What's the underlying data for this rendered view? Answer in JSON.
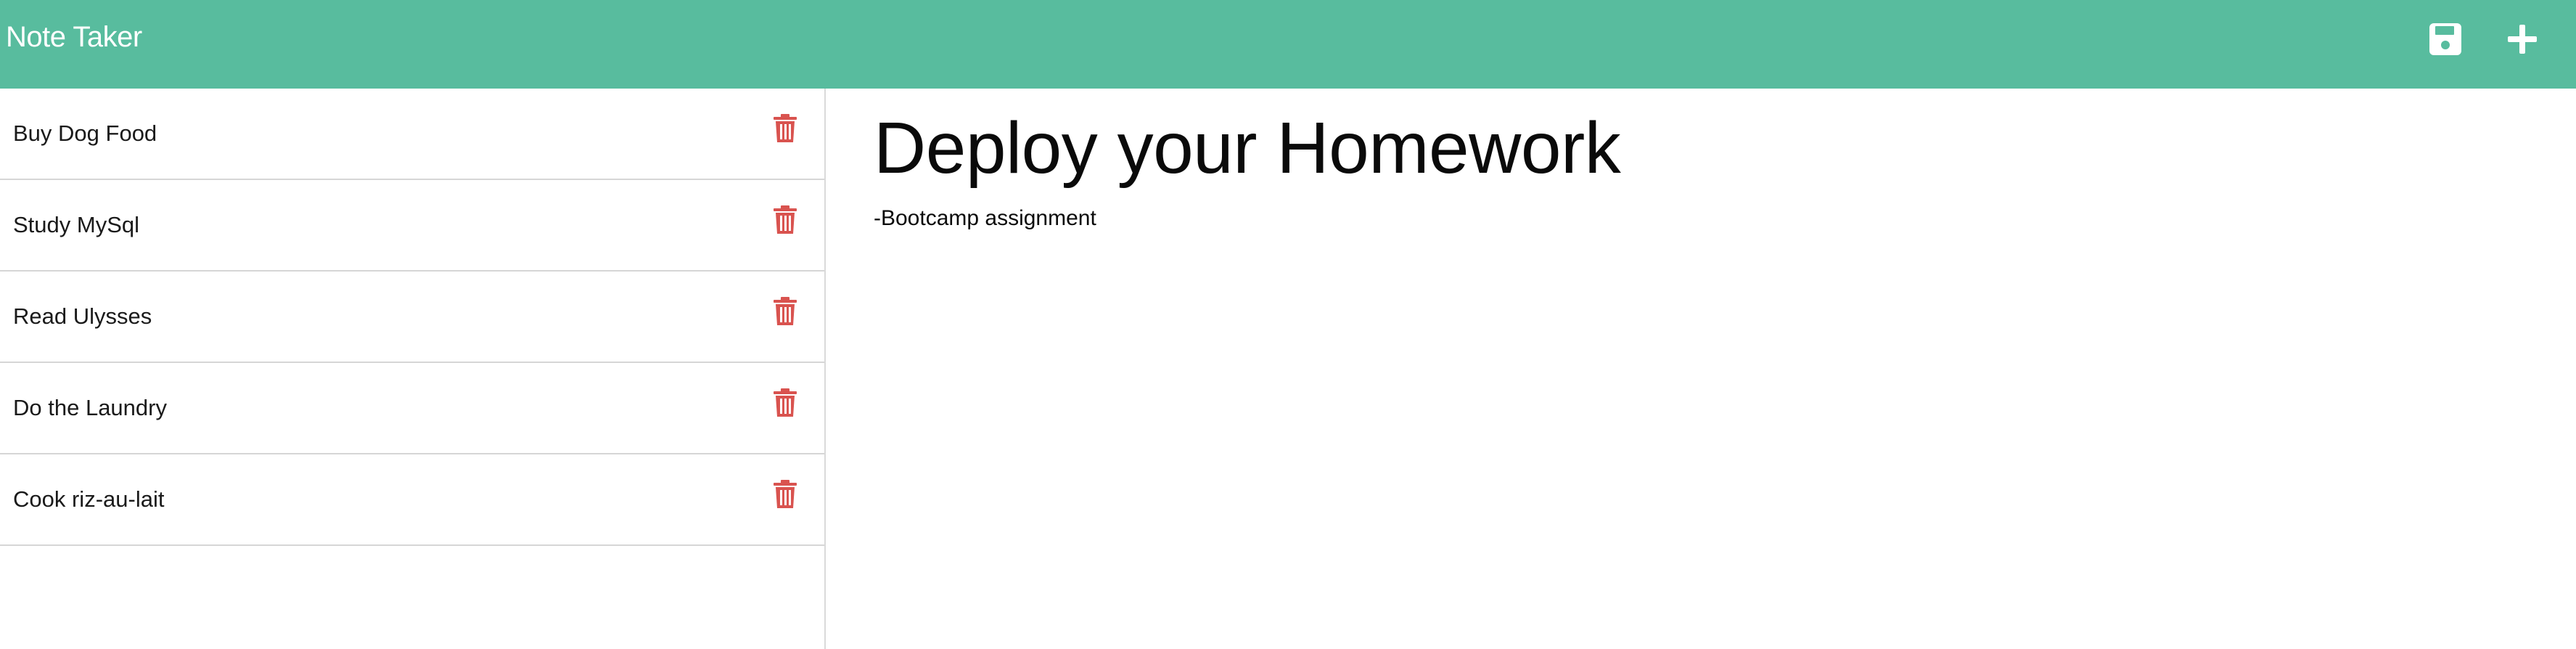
{
  "navbar": {
    "brand": "Note Taker",
    "icons": {
      "save": "save-icon",
      "add": "plus-icon"
    },
    "color": "#58bc9e"
  },
  "sidebar": {
    "notes": [
      {
        "title": "Buy Dog Food"
      },
      {
        "title": "Study MySql"
      },
      {
        "title": "Read Ulysses"
      },
      {
        "title": "Do the Laundry"
      },
      {
        "title": "Cook riz-au-lait"
      }
    ],
    "delete_icon": "trash-icon",
    "delete_color": "#d9534f"
  },
  "editor": {
    "title": "Deploy your Homework",
    "body": "-Bootcamp assignment"
  }
}
